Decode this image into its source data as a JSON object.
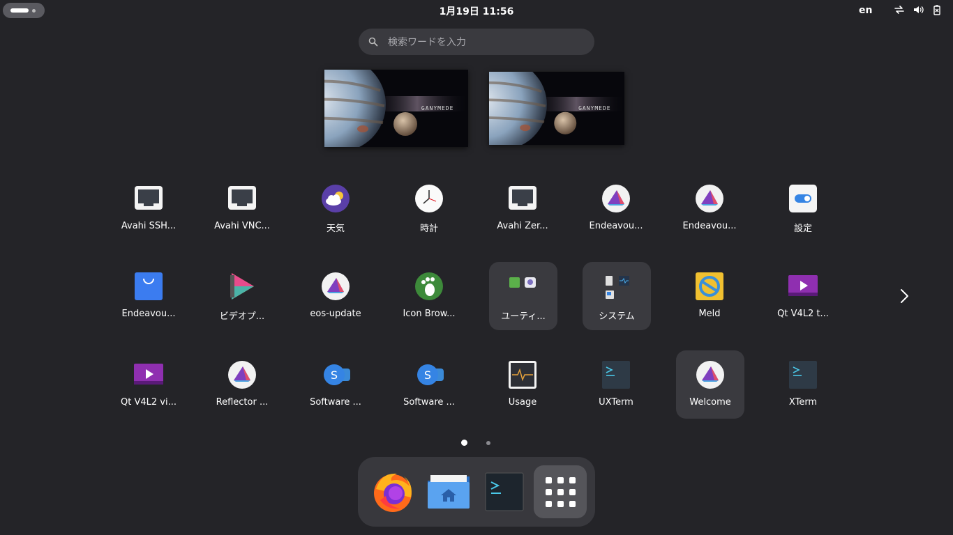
{
  "topbar": {
    "clock": "1月19日  11:56",
    "lang": "en",
    "tray_icons": [
      "network-icon",
      "volume-icon",
      "battery-icon"
    ]
  },
  "search": {
    "placeholder": "検索ワードを入力"
  },
  "workspaces": [
    {
      "label": "GANYMEDE"
    },
    {
      "label": "GANYMEDE"
    }
  ],
  "apps": [
    {
      "label": "Avahi SSH...",
      "icon": "monitor-icon"
    },
    {
      "label": "Avahi VNC...",
      "icon": "monitor-icon"
    },
    {
      "label": "天気",
      "icon": "weather-icon"
    },
    {
      "label": "時計",
      "icon": "clock-icon"
    },
    {
      "label": "Avahi Zer...",
      "icon": "monitor-icon"
    },
    {
      "label": "Endeavou...",
      "icon": "endeavour-icon"
    },
    {
      "label": "Endeavou...",
      "icon": "endeavour-icon"
    },
    {
      "label": "設定",
      "icon": "settings-toggle-icon"
    },
    {
      "label": "Endeavou...",
      "icon": "shopping-bag-icon"
    },
    {
      "label": "ビデオプ...",
      "icon": "video-player-icon"
    },
    {
      "label": "eos-update",
      "icon": "endeavour-icon"
    },
    {
      "label": "Icon Brow...",
      "icon": "gnome-foot-icon"
    },
    {
      "label": "ユーティ...",
      "icon": "folder-utilities-icon"
    },
    {
      "label": "システム",
      "icon": "folder-system-icon"
    },
    {
      "label": "Meld",
      "icon": "meld-icon"
    },
    {
      "label": "Qt V4L2 t...",
      "icon": "qt-v4l2-icon"
    },
    {
      "label": "Qt V4L2 vi...",
      "icon": "qt-v4l2-icon"
    },
    {
      "label": "Reflector ...",
      "icon": "endeavour-icon"
    },
    {
      "label": "Software ...",
      "icon": "software-icon"
    },
    {
      "label": "Software ...",
      "icon": "software-icon"
    },
    {
      "label": "Usage",
      "icon": "usage-monitor-icon"
    },
    {
      "label": "UXTerm",
      "icon": "terminal-icon"
    },
    {
      "label": "Welcome",
      "icon": "endeavour-icon"
    },
    {
      "label": "XTerm",
      "icon": "terminal-icon"
    }
  ],
  "pagination": {
    "pages": 2,
    "current": 1
  },
  "dock": [
    {
      "name": "firefox-icon"
    },
    {
      "name": "home-folder-icon"
    },
    {
      "name": "terminal-icon"
    },
    {
      "name": "show-apps-icon"
    }
  ],
  "colors": {
    "background": "#242428",
    "search_bg": "#3a3a3f",
    "highlight": "#3a3a3f",
    "dash_bg": "#38383d",
    "endeavour_purple": "#7f3fbf",
    "accent_blue": "#3584e4"
  }
}
